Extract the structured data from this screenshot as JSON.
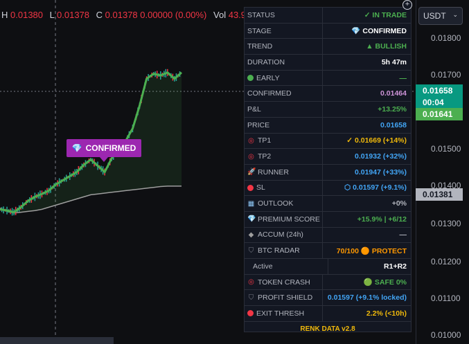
{
  "ohlc": {
    "h_label": "H",
    "h_value": "0.01380",
    "l_label": "L",
    "l_value": "0.01378",
    "c_label": "C",
    "c_value": "0.01378 0.00000 (0.00%)",
    "vol_label": "Vol",
    "vol_value": "43.98K"
  },
  "currency": {
    "value": "USDT",
    "chevron": "⌄"
  },
  "price_axis": {
    "ticks": [
      "0.01800",
      "0.01700",
      "0.01500",
      "0.01400",
      "0.01300",
      "0.01200",
      "0.01100",
      "0.01000"
    ],
    "badges": {
      "last_price": "0.01658",
      "countdown": "00:04",
      "green_price": "0.01641",
      "gray_price": "0.01381"
    }
  },
  "chart_label": {
    "text": "CONFIRMED",
    "icon": "diamond-icon"
  },
  "panel": {
    "rows": [
      {
        "label": "STATUS",
        "value": "✓ IN TRADE",
        "color": "#4caf50"
      },
      {
        "label": "STAGE",
        "value": "💎 CONFIRMED",
        "color": "#ffffff"
      },
      {
        "label": "TREND",
        "value": "▲ BULLISH",
        "color": "#4caf50"
      },
      {
        "label": "DURATION",
        "value": "5h 47m",
        "color": "#ffffff"
      },
      {
        "label": "EARLY",
        "value": "—",
        "color": "#4caf50",
        "icon": "green-dot-icon"
      },
      {
        "label": "CONFIRMED",
        "value": "0.01464",
        "color": "#ce93d8"
      },
      {
        "label": "P&L",
        "value": "+13.25%",
        "color": "#4caf50"
      },
      {
        "label": "PRICE",
        "value": "0.01658",
        "color": "#42a5f5"
      },
      {
        "label": "TP1",
        "value": "✓ 0.01669  (+14%)",
        "color": "#f0b90b",
        "icon": "target-icon"
      },
      {
        "label": "TP2",
        "value": "0.01932  (+32%)",
        "color": "#42a5f5",
        "icon": "target-icon"
      },
      {
        "label": "RUNNER",
        "value": "0.01947  (+33%)",
        "color": "#42a5f5",
        "icon": "rocket-icon"
      },
      {
        "label": "SL",
        "value": "⬡ 0.01597  (+9.1%)",
        "color": "#42a5f5",
        "icon": "red-dot-icon"
      },
      {
        "label": "OUTLOOK",
        "value": "+0%",
        "color": "#b2b5be",
        "icon": "chart-icon"
      },
      {
        "label": "PREMIUM SCORE",
        "value": "+15.9% | +6/12",
        "color": "#4caf50",
        "icon": "diamond-icon"
      },
      {
        "label": "ACCUM (24h)",
        "value": "—",
        "color": "#b2b5be",
        "icon": "small-diamond-icon"
      },
      {
        "label": "BTC RADAR",
        "value": "70/100 🟠 PROTECT",
        "color": "#ff9800",
        "icon": "shield-icon"
      },
      {
        "label": "Active",
        "value": "R1+R2",
        "color": "#ffffff"
      },
      {
        "label": "TOKEN CRASH",
        "value": "🟢 SAFE  0%",
        "color": "#4caf50",
        "icon": "target-icon"
      },
      {
        "label": "PROFIT SHIELD",
        "value": "0.01597  (+9.1% locked)",
        "color": "#42a5f5",
        "icon": "shield-icon"
      },
      {
        "label": "EXIT THRESH",
        "value": "2.2% (<10h)",
        "color": "#f0b90b",
        "icon": "red-dot-icon"
      }
    ],
    "footer": "RENK DATA v2.8"
  },
  "chart_data": {
    "type": "line",
    "x": [
      0,
      1,
      2,
      3,
      4,
      5,
      6,
      7,
      8,
      9,
      10,
      11,
      12,
      13,
      14,
      15,
      16,
      17,
      18,
      19,
      20,
      21,
      22,
      23,
      24,
      25,
      26
    ],
    "series": [
      {
        "values": [
          0.01325,
          0.01322,
          0.01318,
          0.0133,
          0.01345,
          0.01355,
          0.01362,
          0.0137,
          0.01385,
          0.01395,
          0.01405,
          0.01415,
          0.01432,
          0.01445,
          0.0143,
          0.01415,
          0.01448,
          0.0147,
          0.0149,
          0.0152,
          0.01575,
          0.0164,
          0.01652,
          0.01648,
          0.01655,
          0.0164,
          0.01655
        ]
      },
      {
        "values": [
          0.01328,
          0.0132,
          0.01316,
          0.01318,
          0.0132,
          0.01322,
          0.01325,
          0.0133,
          0.01335,
          0.0134,
          0.01345,
          0.0135,
          0.01355,
          0.0136,
          0.01362,
          0.01364,
          0.01366,
          0.01368,
          0.0137,
          0.01372,
          0.01374,
          0.01376,
          0.01378,
          0.0138,
          0.01381,
          0.01381,
          0.01381
        ]
      }
    ],
    "ylim": [
      0.01,
      0.0183
    ]
  }
}
